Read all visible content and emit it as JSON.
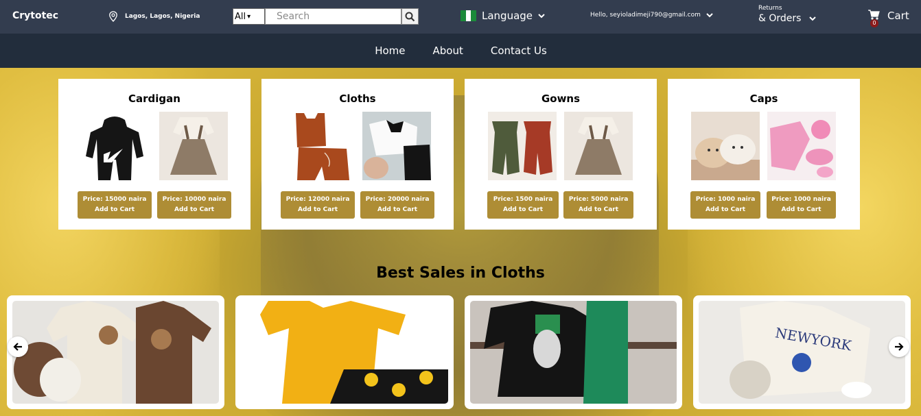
{
  "header": {
    "logo": "Crytotec",
    "location": "Lagos, Lagos, Nigeria",
    "search_category": "All",
    "search_placeholder": "Search",
    "language_label": "Language",
    "greeting": "Hello, seyioladimeji790@gmail.com",
    "returns_small": "Returns",
    "returns_big": "& Orders",
    "cart_label": "Cart",
    "cart_count": "0"
  },
  "nav": {
    "items": [
      "Home",
      "About",
      "Contact Us"
    ]
  },
  "categories": [
    {
      "title": "Cardigan",
      "products": [
        {
          "price": "Price: 15000 naira",
          "cta": "Add to Cart"
        },
        {
          "price": "Price: 10000 naira",
          "cta": "Add to Cart"
        }
      ]
    },
    {
      "title": "Cloths",
      "products": [
        {
          "price": "Price: 12000 naira",
          "cta": "Add to Cart"
        },
        {
          "price": "Price: 20000 naira",
          "cta": "Add to Cart"
        }
      ]
    },
    {
      "title": "Gowns",
      "products": [
        {
          "price": "Price: 1500 naira",
          "cta": "Add to Cart"
        },
        {
          "price": "Price: 5000 naira",
          "cta": "Add to Cart"
        }
      ]
    },
    {
      "title": "Caps",
      "products": [
        {
          "price": "Price: 1000 naira",
          "cta": "Add to Cart"
        },
        {
          "price": "Price: 1000 naira",
          "cta": "Add to Cart"
        }
      ]
    }
  ],
  "best_sales": {
    "title": "Best Sales in Cloths"
  },
  "icons": {
    "location": "map-pin-icon",
    "search": "search-icon",
    "cart": "cart-icon",
    "prev": "arrow-left-icon",
    "next": "arrow-right-icon"
  },
  "colors": {
    "topbar": "#333d4f",
    "navbar": "#222d3c",
    "button": "#ae8d35",
    "hero": "#d8b63a"
  }
}
